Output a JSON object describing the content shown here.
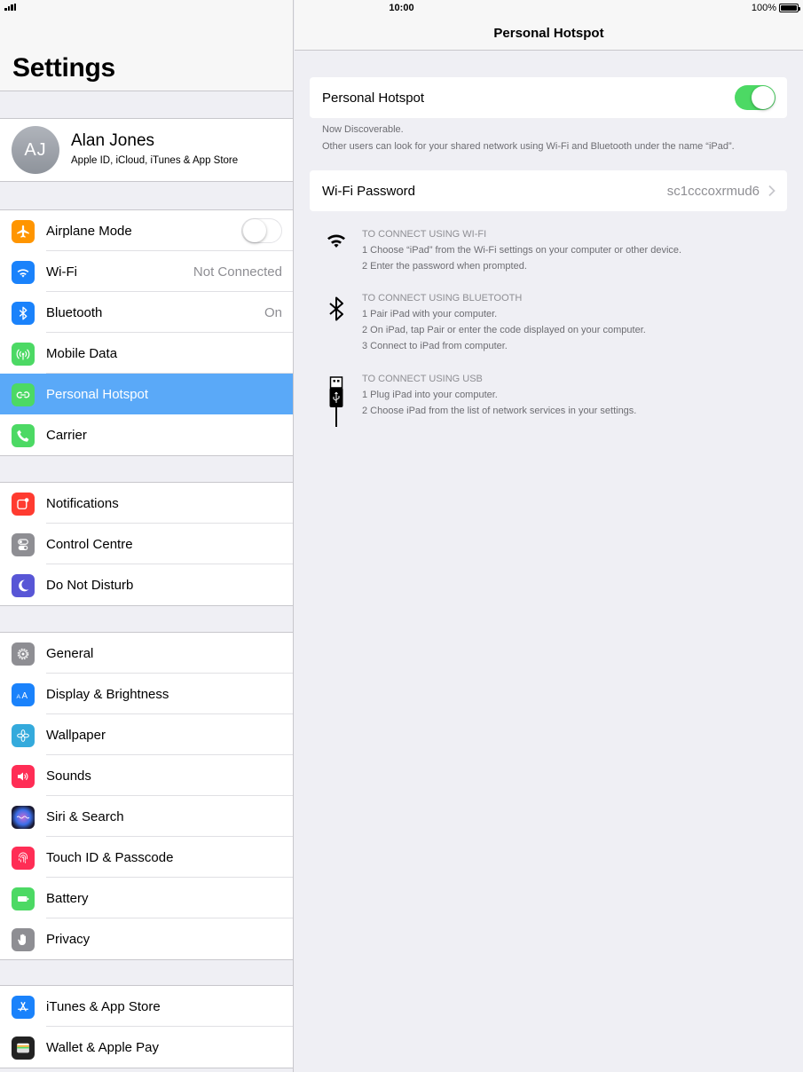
{
  "status_bar": {
    "time": "10:00",
    "battery": "100%"
  },
  "sidebar": {
    "title": "Settings",
    "profile": {
      "initials": "AJ",
      "name": "Alan Jones",
      "subtitle": "Apple ID, iCloud, iTunes & App Store"
    },
    "groups": [
      [
        {
          "label": "Airplane Mode",
          "icon": "airplane-icon",
          "color": "#ff9500",
          "switch": "off"
        },
        {
          "label": "Wi-Fi",
          "icon": "wifi-icon",
          "color": "#1a82fb",
          "value": "Not Connected"
        },
        {
          "label": "Bluetooth",
          "icon": "bluetooth-icon",
          "color": "#1a82fb",
          "value": "On"
        },
        {
          "label": "Mobile Data",
          "icon": "antenna-icon",
          "color": "#4cd964"
        },
        {
          "label": "Personal Hotspot",
          "icon": "hotspot-icon",
          "color": "#4cd964",
          "selected": true
        },
        {
          "label": "Carrier",
          "icon": "phone-icon",
          "color": "#4cd964"
        }
      ],
      [
        {
          "label": "Notifications",
          "icon": "notifications-icon",
          "color": "#ff3b30"
        },
        {
          "label": "Control Centre",
          "icon": "control-centre-icon",
          "color": "#8e8e93"
        },
        {
          "label": "Do Not Disturb",
          "icon": "moon-icon",
          "color": "#5856d6"
        }
      ],
      [
        {
          "label": "General",
          "icon": "gear-icon",
          "color": "#8e8e93"
        },
        {
          "label": "Display & Brightness",
          "icon": "text-size-icon",
          "color": "#1a82fb"
        },
        {
          "label": "Wallpaper",
          "icon": "flower-icon",
          "color": "#34aadc"
        },
        {
          "label": "Sounds",
          "icon": "speaker-icon",
          "color": "#ff2d55"
        },
        {
          "label": "Siri & Search",
          "icon": "siri-icon",
          "color": "#222244"
        },
        {
          "label": "Touch ID & Passcode",
          "icon": "fingerprint-icon",
          "color": "#ff2d55"
        },
        {
          "label": "Battery",
          "icon": "battery-icon",
          "color": "#4cd964"
        },
        {
          "label": "Privacy",
          "icon": "hand-icon",
          "color": "#8e8e93"
        }
      ],
      [
        {
          "label": "iTunes & App Store",
          "icon": "app-store-icon",
          "color": "#1a82fb"
        },
        {
          "label": "Wallet & Apple Pay",
          "icon": "wallet-icon",
          "color": "#222222"
        }
      ]
    ]
  },
  "detail": {
    "title": "Personal Hotspot",
    "hotspot": {
      "label": "Personal Hotspot",
      "enabled": true
    },
    "discoverable": "Now Discoverable.",
    "discoverable_note": "Other users can look for your shared network using Wi-Fi and Bluetooth under the name “iPad”.",
    "wifi_password": {
      "label": "Wi-Fi Password",
      "value": "sc1cccoxrmud6"
    },
    "instructions": [
      {
        "icon": "wifi-icon",
        "title": "TO CONNECT USING WI-FI",
        "steps": [
          "1 Choose “iPad” from the Wi-Fi settings on your computer or other device.",
          "2 Enter the password when prompted."
        ]
      },
      {
        "icon": "bluetooth-icon",
        "title": "TO CONNECT USING BLUETOOTH",
        "steps": [
          "1 Pair iPad with your computer.",
          "2 On iPad, tap Pair or enter the code displayed on your computer.",
          "3 Connect to iPad from computer."
        ]
      },
      {
        "icon": "usb-cable-icon",
        "title": "TO CONNECT USING USB",
        "steps": [
          "1 Plug iPad into your computer.",
          "2 Choose iPad from the list of network services in your settings."
        ]
      }
    ]
  }
}
